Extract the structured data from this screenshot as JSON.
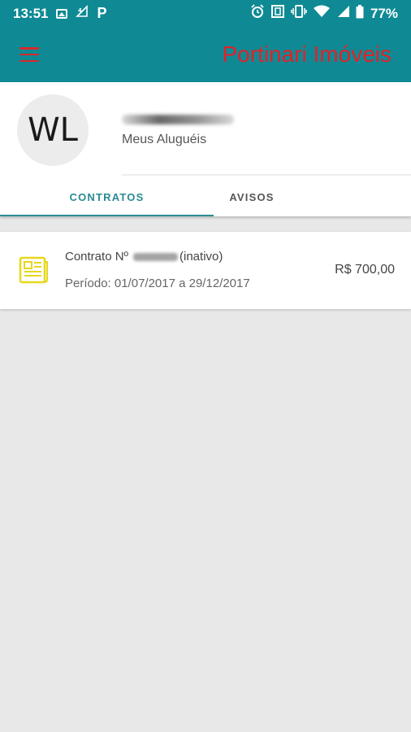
{
  "status_bar": {
    "time": "13:51",
    "left_icons": [
      "image-icon",
      "signal-4g-icon",
      "p-app-icon"
    ],
    "p_glyph": "P",
    "right_icons": [
      "alarm-icon",
      "nfc-icon",
      "vibrate-icon",
      "wifi-icon",
      "cell-signal-icon",
      "battery-icon"
    ],
    "battery": "77%"
  },
  "app_bar": {
    "title": "Portinari Imóveis",
    "colors": {
      "primary": "#0f8a94",
      "title": "#e0222a",
      "menu": "#d42a2a"
    }
  },
  "profile": {
    "initials": "WL",
    "subtitle": "Meus Aluguéis"
  },
  "tabs": [
    {
      "label": "CONTRATOS",
      "active": true
    },
    {
      "label": "AVISOS",
      "active": false
    }
  ],
  "contracts": [
    {
      "prefix": "Contrato Nº",
      "status": "(inativo)",
      "period": "Período: 01/07/2017 a 29/12/2017",
      "price": "R$ 700,00",
      "icon": "document-icon",
      "icon_color": "#e6d81c"
    }
  ]
}
